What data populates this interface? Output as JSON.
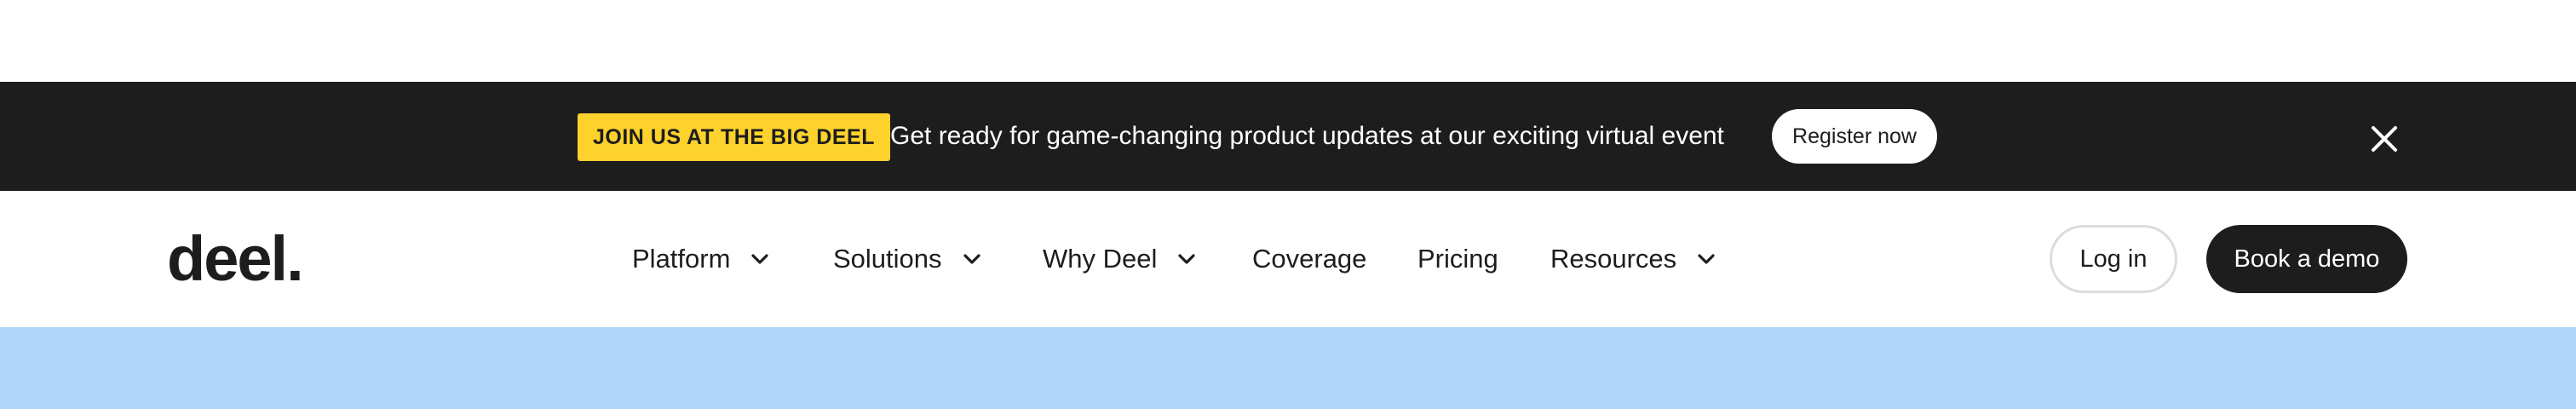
{
  "announcement": {
    "badge": "JOIN US AT THE BIG DEEL",
    "text": "Get ready for game-changing product updates at our exciting virtual event",
    "register_label": "Register now",
    "close_icon": "close-icon",
    "background": "#1d1d1d",
    "badge_color": "#fdd22d"
  },
  "nav": {
    "logo": "deel.",
    "items": [
      {
        "label": "Platform",
        "icon": "chevron-down-icon"
      },
      {
        "label": "Solutions",
        "icon": "chevron-down-icon"
      },
      {
        "label": "Why Deel",
        "icon": "chevron-down-icon"
      },
      {
        "label": "Coverage"
      },
      {
        "label": "Pricing"
      },
      {
        "label": "Resources",
        "icon": "chevron-down-icon"
      }
    ],
    "login_label": "Log in",
    "demo_label": "Book a demo"
  },
  "hero": {
    "background": "#b0d6f9"
  }
}
